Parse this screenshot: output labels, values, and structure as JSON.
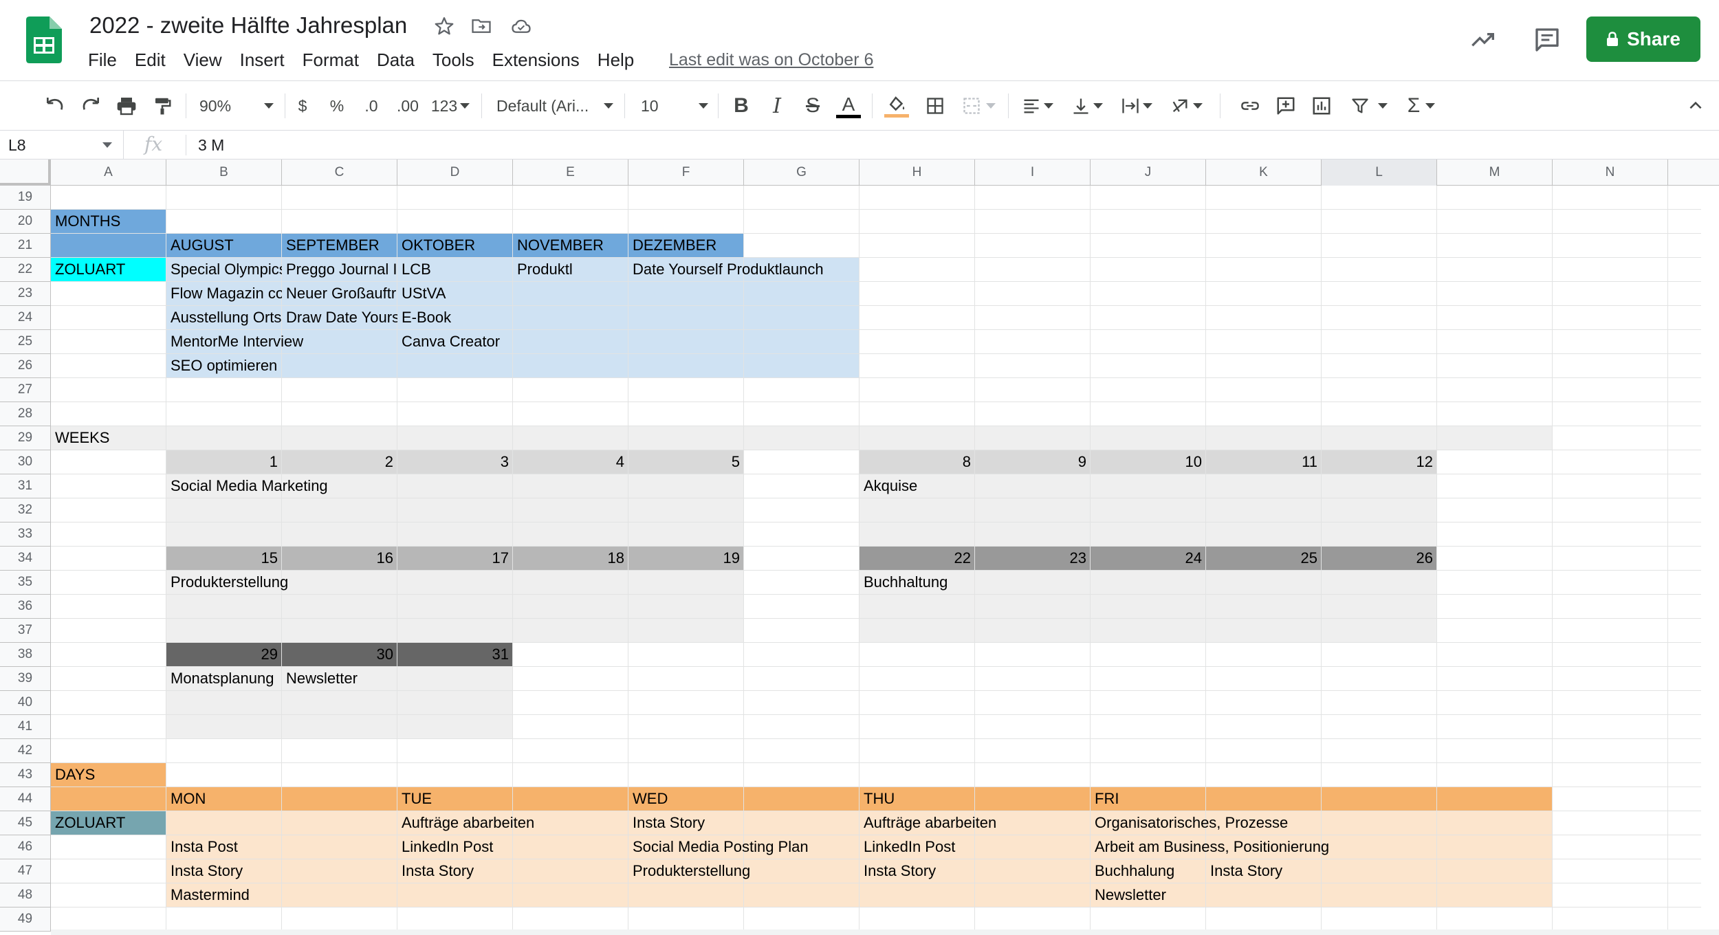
{
  "app": {
    "title": "2022 - zweite Hälfte Jahresplan",
    "menu": [
      "File",
      "Edit",
      "View",
      "Insert",
      "Format",
      "Data",
      "Tools",
      "Extensions",
      "Help"
    ],
    "last_edit": "Last edit was on October 6",
    "share_label": "Share",
    "brand_color": "#1e8e3e"
  },
  "toolbar": {
    "zoom": "90%",
    "currency": "$",
    "percent": "%",
    "decrease_decimal": ".0",
    "increase_decimal": ".00",
    "number_format": "123",
    "font": "Default (Ari...",
    "font_size": "10",
    "icons": [
      "undo-icon",
      "redo-icon",
      "print-icon",
      "paint-format-icon",
      "bold-icon",
      "italic-icon",
      "strikethrough-icon",
      "text-color-icon",
      "fill-color-icon",
      "borders-icon",
      "merge-cells-icon",
      "align-horizontal-icon",
      "align-vertical-icon",
      "text-wrap-icon",
      "text-rotate-icon",
      "link-icon",
      "comment-icon",
      "chart-icon",
      "filter-icon",
      "functions-icon",
      "collapse-icon"
    ]
  },
  "formula_bar": {
    "cell_ref": "L8",
    "fx": "fx",
    "content": "3 M"
  },
  "columns": [
    "A",
    "B",
    "C",
    "D",
    "E",
    "F",
    "G",
    "H",
    "I",
    "J",
    "K",
    "L",
    "M",
    "N"
  ],
  "selected_column": "L",
  "rows": [
    "19",
    "20",
    "21",
    "22",
    "23",
    "24",
    "25",
    "26",
    "27",
    "28",
    "29",
    "30",
    "31",
    "32",
    "33",
    "34",
    "35",
    "36",
    "37",
    "38",
    "39",
    "40",
    "41",
    "42",
    "43",
    "44",
    "45",
    "46",
    "47",
    "48",
    "49"
  ],
  "cells": {
    "A20": "MONTHS",
    "B21": "AUGUST",
    "C21": "SEPTEMBER",
    "D21": "OKTOBER",
    "E21": "NOVEMBER",
    "F21": "DEZEMBER",
    "A22": "ZOLUART",
    "B22": "Special Olympics",
    "C22": "Preggo Journal I",
    "D22": "LCB",
    "E22": "Produktl",
    "F22": "Date Yourself Produktlaunch",
    "B23": "Flow Magazin co",
    "C23": "Neuer Großauftr",
    "D23": "UStVA",
    "B24": "Ausstellung Orts",
    "C24": "Draw Date Yours",
    "D24": "E-Book",
    "B25": "MentorMe Interview",
    "D25": "Canva Creator",
    "B26": "SEO optimieren",
    "A29": "WEEKS",
    "B30": "1",
    "C30": "2",
    "D30": "3",
    "E30": "4",
    "F30": "5",
    "H30": "8",
    "I30": "9",
    "J30": "10",
    "K30": "11",
    "L30": "12",
    "B31": "Social Media Marketing",
    "H31": "Akquise",
    "B34": "15",
    "C34": "16",
    "D34": "17",
    "E34": "18",
    "F34": "19",
    "H34": "22",
    "I34": "23",
    "J34": "24",
    "K34": "25",
    "L34": "26",
    "B35": "Produkterstellung",
    "H35": "Buchhaltung",
    "B38": "29",
    "C38": "30",
    "D38": "31",
    "B39": "Monatsplanung",
    "C39": "Newsletter",
    "A43": "DAYS",
    "B44": "MON",
    "D44": "TUE",
    "F44": "WED",
    "H44": "THU",
    "J44": "FRI",
    "A45": "ZOLUART",
    "D45": "Aufträge abarbeiten",
    "F45": "Insta Story",
    "H45": "Aufträge abarbeiten",
    "J45": "Organisatorisches, Prozesse",
    "B46": "Insta Post",
    "D46": "LinkedIn Post",
    "F46": "Social Media Posting Plan",
    "H46": "LinkedIn Post",
    "J46": "Arbeit am Business, Positionierung",
    "B47": "Insta Story",
    "D47": "Insta Story",
    "F47": "Produkterstellung",
    "H47": "Insta Story",
    "J47": "Buchhalung",
    "K47": "Insta Story",
    "B48": "Mastermind",
    "J48": "Newsletter"
  },
  "colors": {
    "months_header": "#6fa8dc",
    "months_body": "#cfe2f3",
    "zoluart_cyan": "#00ffff",
    "weeks_band": "#efefef",
    "week_row_light": "#d9d9d9",
    "week_row_mid": "#b7b7b7",
    "week_row_dark": "#999999",
    "week_row_darkest": "#666666",
    "days_header": "#f6b26b",
    "days_body": "#fce5cd",
    "zoluart_teal": "#76a5af"
  }
}
